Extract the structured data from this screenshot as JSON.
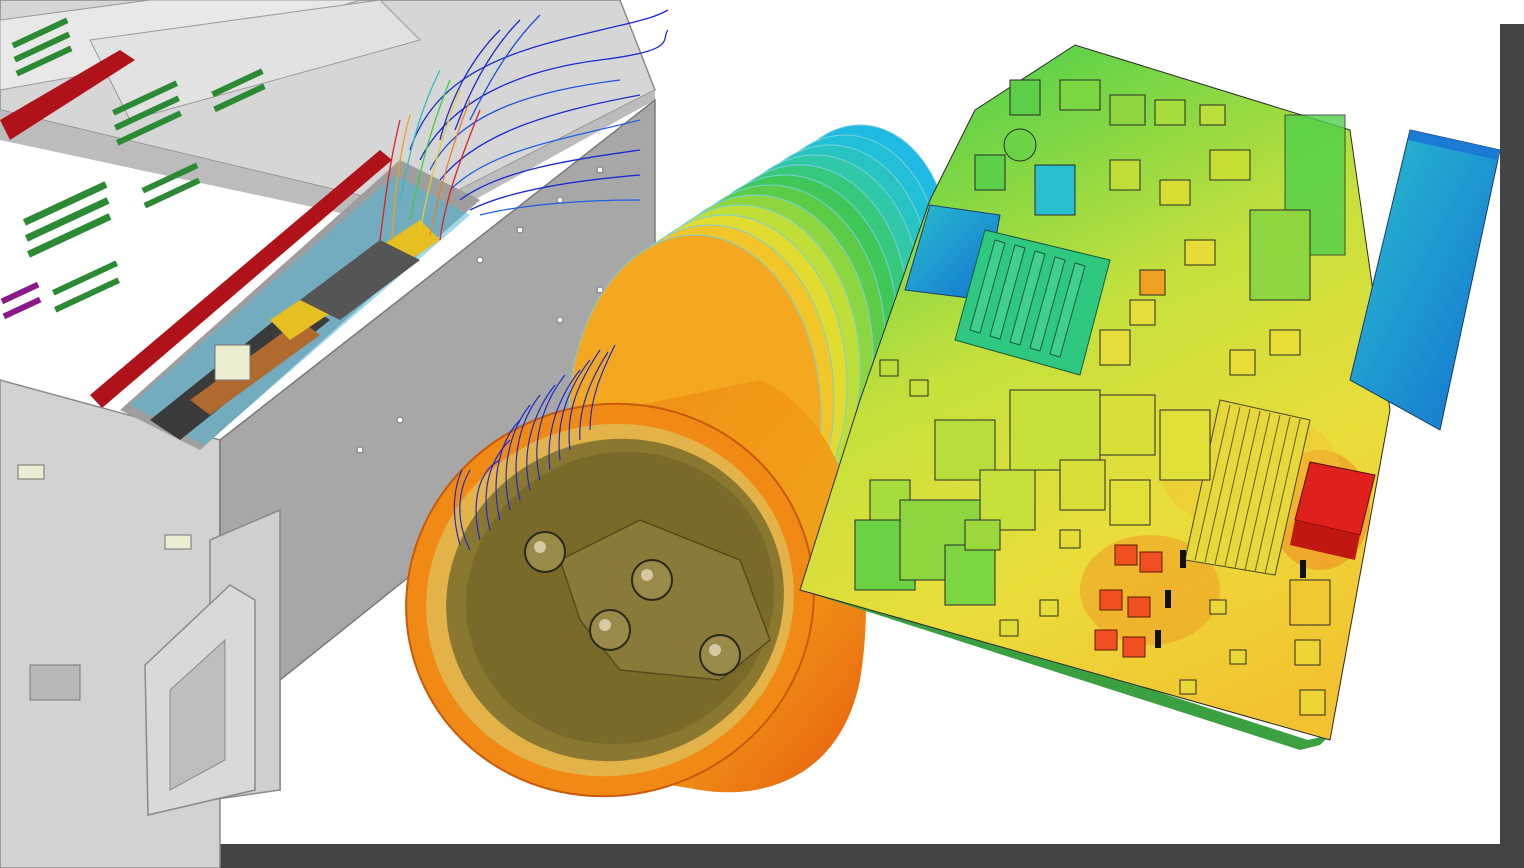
{
  "image": {
    "subject": "",
    "panels": [
      {
        "id": "enclosure",
        "kind": "cad-model",
        "palette": [
          "#c9c9c9",
          "#a8a8a8",
          "#b0121a",
          "#2c8a34"
        ]
      },
      {
        "id": "heat-sink",
        "kind": "cad-model",
        "palette": [
          "#e8640c",
          "#f3a21a",
          "#3fc046",
          "#1fb9e4"
        ]
      },
      {
        "id": "circuit-board",
        "kind": "cad-model",
        "palette": [
          "#1a7ad4",
          "#25b8c8",
          "#4fd04a",
          "#e6e63c",
          "#f09a24",
          "#e0201c"
        ]
      }
    ],
    "frame": {
      "shadow_color": "#444444",
      "background": "#ffffff"
    }
  }
}
